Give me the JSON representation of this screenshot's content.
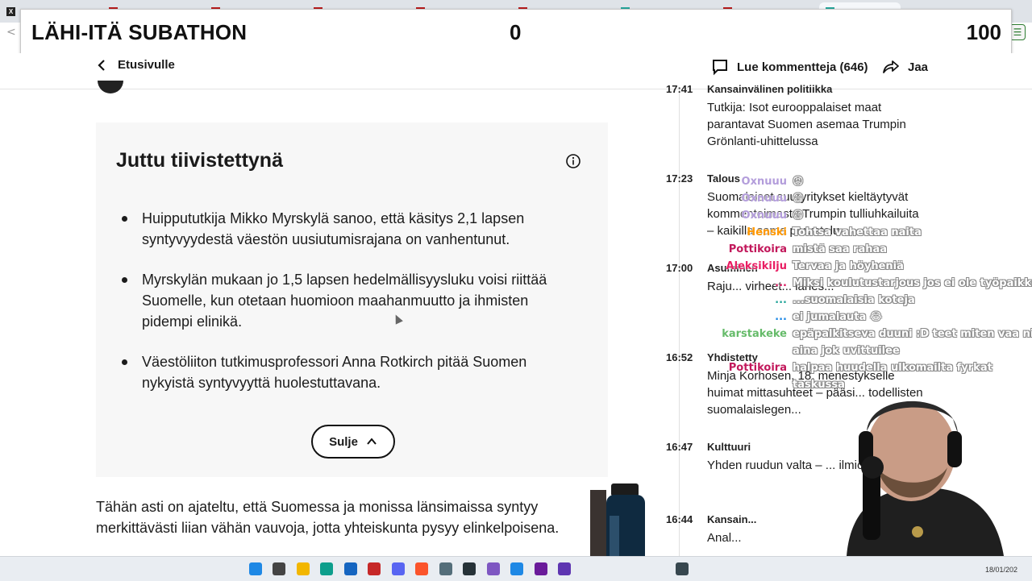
{
  "browser": {
    "tabs": [
      {
        "icon": "x-icon"
      },
      {
        "icon": "red-x-icon"
      },
      {
        "icon": "red-x-icon"
      },
      {
        "icon": "red-x-icon"
      },
      {
        "icon": "red-x-icon"
      },
      {
        "icon": "red-x-icon"
      },
      {
        "icon": "teal-icon"
      },
      {
        "icon": "red-x-icon"
      },
      {
        "icon": "teal-icon",
        "active": true
      }
    ]
  },
  "subathon": {
    "title": "LÄHI-ITÄ SUBATHON",
    "count": "0",
    "goal": "100"
  },
  "header": {
    "back_label": "Etusivulle",
    "comments_label": "Lue kommentteja (646)",
    "share_label": "Jaa"
  },
  "summary": {
    "title": "Juttu tiivistettynä",
    "bullets": [
      "Huippututkija Mikko Myrskylä sanoo, että käsitys 2,1 lapsen syntyvyydestä väestön uusiutumisrajana on vanhentunut.",
      "Myrskylän mukaan jo 1,5 lapsen hedelmällisyysluku voisi riittää Suomelle, kun otetaan huomioon maahanmuutto ja ihmisten pidempi elinikä.",
      "Väestöliiton tutkimusprofessori Anna Rotkirch pitää Suomen nykyistä syntyvyyttä huolestuttavana."
    ],
    "close_label": "Sulje"
  },
  "article": {
    "body_line1": "Tähän asti on ajateltu, että Suomessa ja monissa länsimaissa syntyy",
    "body_line2": "merkittävästi liian vähän vauvoja, jotta yhteiskunta pysyy elinkelpoisena."
  },
  "feed": [
    {
      "time": "17:41",
      "category": "Kansainvälinen politiikka",
      "headline": "Tutkija: Isot eurooppalaiset maat parantavat Suomen asemaa Trumpin Grönlanti-uhittelussa"
    },
    {
      "time": "17:23",
      "category": "Talous",
      "headline": "Suomalaiset suuryritykset kieltäytyvät kommentoimasta Trumpin tulliuhkailuita – kaikilla sama perustelu"
    },
    {
      "time": "17:00",
      "category": "Asuminen",
      "headline": "Raju... virheet... lähes..."
    },
    {
      "time": "16:52",
      "category": "Yhdistetty",
      "headline": "Minja Korhosen, 18, menestykselle huimat mittasuhteet – pääsi... todellisten suomalaislegen..."
    },
    {
      "time": "16:47",
      "category": "Kulttuuri",
      "headline": "Yhden ruudun valta – ... ilmiöitä ysär..."
    },
    {
      "time": "16:44",
      "category": "Kansain...",
      "headline": "Anal..."
    }
  ],
  "chat": [
    {
      "user": "Oxnuuu",
      "text": "😡",
      "color": "#b39ddb"
    },
    {
      "user": "Oxnuuu",
      "text": "😄",
      "color": "#b39ddb"
    },
    {
      "user": "Oxnuuu",
      "text": "😄",
      "color": "#b39ddb"
    },
    {
      "user": "Henski",
      "text": "Tohtsa vahettaa naita",
      "color": "#ff9800"
    },
    {
      "user": "Pottikoira",
      "text": "mistä saa rahaa",
      "color": "#c2185b"
    },
    {
      "user": "Aleksikilju",
      "text": "Tervaa ja höyheniä",
      "color": "#e91e63"
    },
    {
      "user": "...",
      "text": "Miksi koulutustarjous jos ei ole työpaikkaa",
      "color": "#d81b60"
    },
    {
      "user": "...",
      "text": "...suomalaisia koteja",
      "color": "#26a69a"
    },
    {
      "user": "...",
      "text": "ei jumalauta 😂",
      "color": "#1e88e5"
    },
    {
      "user": "karstakeke",
      "text": "epäpalkitseva duuni :D teet miten vaa ni",
      "color": "#66bb6a"
    },
    {
      "user": "",
      "text": "aina jok uvittuilee",
      "color": "#66bb6a"
    },
    {
      "user": "Pottikoira",
      "text": "halpaa huudella ulkomailta fyrkat",
      "color": "#c2185b"
    },
    {
      "user": "",
      "text": "taskussa",
      "color": "#c2185b"
    }
  ],
  "taskbar": {
    "date": "18/01/202"
  }
}
